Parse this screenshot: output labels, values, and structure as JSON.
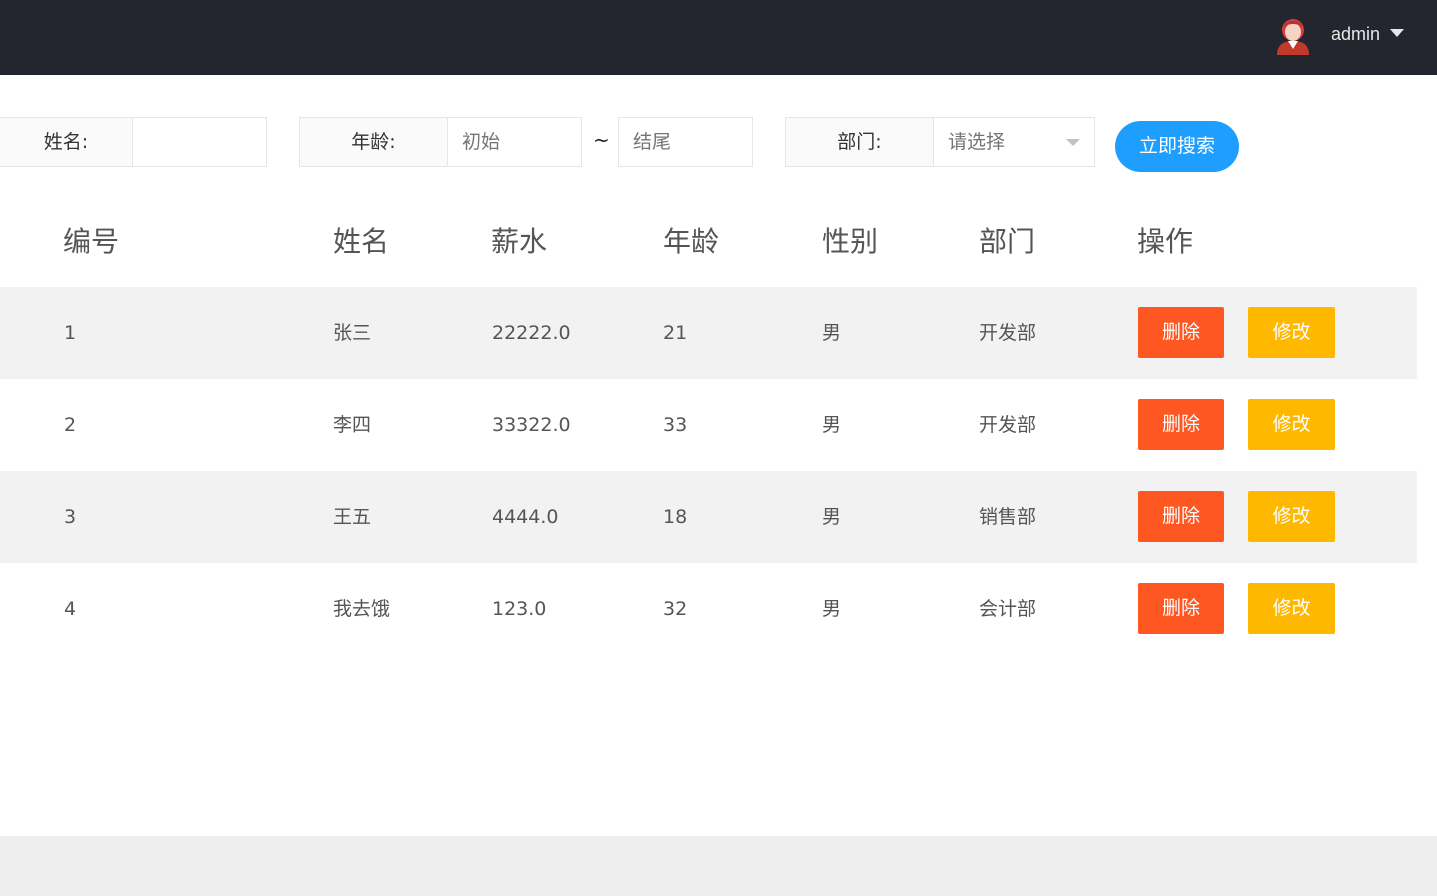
{
  "header": {
    "user_name": "admin",
    "avatar_icon": "user-avatar-icon",
    "dropdown_icon": "caret-down-icon"
  },
  "search": {
    "name_label": "姓名:",
    "name_value": "",
    "age_label": "年龄:",
    "age_start_placeholder": "初始",
    "age_separator": "~",
    "age_end_placeholder": "结尾",
    "dept_label": "部门:",
    "dept_selected": "请选择",
    "search_button": "立即搜索"
  },
  "table": {
    "headers": [
      "编号",
      "姓名",
      "薪水",
      "年龄",
      "性别",
      "部门",
      "操作"
    ],
    "rows": [
      {
        "id": "1",
        "name": "张三",
        "salary": "22222.0",
        "age": "21",
        "gender": "男",
        "dept": "开发部",
        "delete": "删除",
        "edit": "修改"
      },
      {
        "id": "2",
        "name": "李四",
        "salary": "33322.0",
        "age": "33",
        "gender": "男",
        "dept": "开发部",
        "delete": "删除",
        "edit": "修改"
      },
      {
        "id": "3",
        "name": "王五",
        "salary": "4444.0",
        "age": "18",
        "gender": "男",
        "dept": "销售部",
        "delete": "删除",
        "edit": "修改"
      },
      {
        "id": "4",
        "name": "我去饿",
        "salary": "123.0",
        "age": "32",
        "gender": "男",
        "dept": "会计部",
        "delete": "删除",
        "edit": "修改"
      }
    ]
  },
  "colors": {
    "topbar": "#23262e",
    "primary": "#1e9fff",
    "danger": "#ff5722",
    "warn": "#ffb800",
    "stripe": "#f2f2f2"
  }
}
